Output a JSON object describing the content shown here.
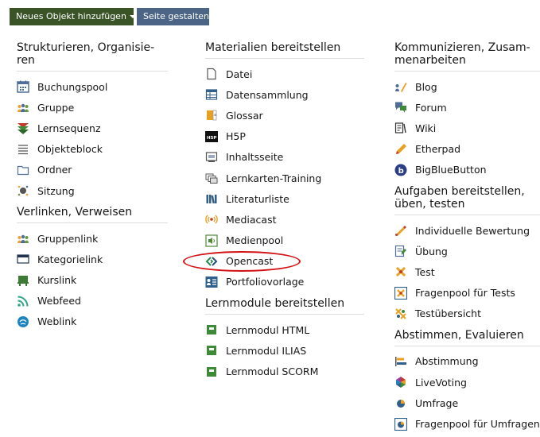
{
  "toolbar": {
    "add_label": "Neues Objekt hinzufügen",
    "design_label": "Seite gestalten"
  },
  "columns": [
    {
      "groups": [
        {
          "title": "Strukturieren, Organisie-ren",
          "items": [
            {
              "label": "Buchungspool",
              "icon": "calendar-icon"
            },
            {
              "label": "Gruppe",
              "icon": "group-icon"
            },
            {
              "label": "Lernsequenz",
              "icon": "learning-sequence-icon"
            },
            {
              "label": "Objekteblock",
              "icon": "list-icon"
            },
            {
              "label": "Ordner",
              "icon": "folder-icon"
            },
            {
              "label": "Sitzung",
              "icon": "session-icon"
            }
          ]
        },
        {
          "title": "Verlinken, Verweisen",
          "items": [
            {
              "label": "Gruppenlink",
              "icon": "group-link-icon"
            },
            {
              "label": "Kategorielink",
              "icon": "category-link-icon"
            },
            {
              "label": "Kurslink",
              "icon": "course-link-icon"
            },
            {
              "label": "Webfeed",
              "icon": "rss-icon"
            },
            {
              "label": "Weblink",
              "icon": "weblink-icon"
            }
          ]
        }
      ]
    },
    {
      "groups": [
        {
          "title": "Materialien bereitstellen",
          "items": [
            {
              "label": "Datei",
              "icon": "file-icon"
            },
            {
              "label": "Datensammlung",
              "icon": "table-icon"
            },
            {
              "label": "Glossar",
              "icon": "glossary-icon"
            },
            {
              "label": "H5P",
              "icon": "h5p-icon"
            },
            {
              "label": "Inhaltsseite",
              "icon": "content-page-icon"
            },
            {
              "label": "Lernkarten-Training",
              "icon": "flashcards-icon"
            },
            {
              "label": "Literaturliste",
              "icon": "books-icon"
            },
            {
              "label": "Mediacast",
              "icon": "broadcast-icon"
            },
            {
              "label": "Medienpool",
              "icon": "speaker-icon"
            },
            {
              "label": "Opencast",
              "icon": "opencast-icon"
            },
            {
              "label": "Portfoliovorlage",
              "icon": "portfolio-icon"
            }
          ]
        },
        {
          "title": "Lernmodule bereitstellen",
          "items": [
            {
              "label": "Lernmodul HTML",
              "icon": "module-icon"
            },
            {
              "label": "Lernmodul ILIAS",
              "icon": "module-icon"
            },
            {
              "label": "Lernmodul SCORM",
              "icon": "module-icon"
            }
          ]
        }
      ]
    },
    {
      "groups": [
        {
          "title": "Kommunizieren, Zusam-menarbeiten",
          "items": [
            {
              "label": "Blog",
              "icon": "blog-icon"
            },
            {
              "label": "Forum",
              "icon": "forum-icon"
            },
            {
              "label": "Wiki",
              "icon": "wiki-icon"
            },
            {
              "label": "Etherpad",
              "icon": "pencil-icon"
            },
            {
              "label": "BigBlueButton",
              "icon": "bigbluebutton-icon"
            }
          ]
        },
        {
          "title": "Aufgaben bereitstellen, üben, testen",
          "items": [
            {
              "label": "Individuelle Bewertung",
              "icon": "assessment-icon"
            },
            {
              "label": "Übung",
              "icon": "exercise-icon"
            },
            {
              "label": "Test",
              "icon": "test-icon"
            },
            {
              "label": "Fragenpool für Tests",
              "icon": "question-pool-icon"
            },
            {
              "label": "Testübersicht",
              "icon": "test-overview-icon"
            }
          ]
        },
        {
          "title": "Abstimmen, Evaluieren",
          "items": [
            {
              "label": "Abstimmung",
              "icon": "poll-icon"
            },
            {
              "label": "LiveVoting",
              "icon": "live-voting-icon"
            },
            {
              "label": "Umfrage",
              "icon": "survey-icon"
            },
            {
              "label": "Fragenpool für Umfragen",
              "icon": "survey-pool-icon"
            }
          ]
        }
      ]
    }
  ]
}
